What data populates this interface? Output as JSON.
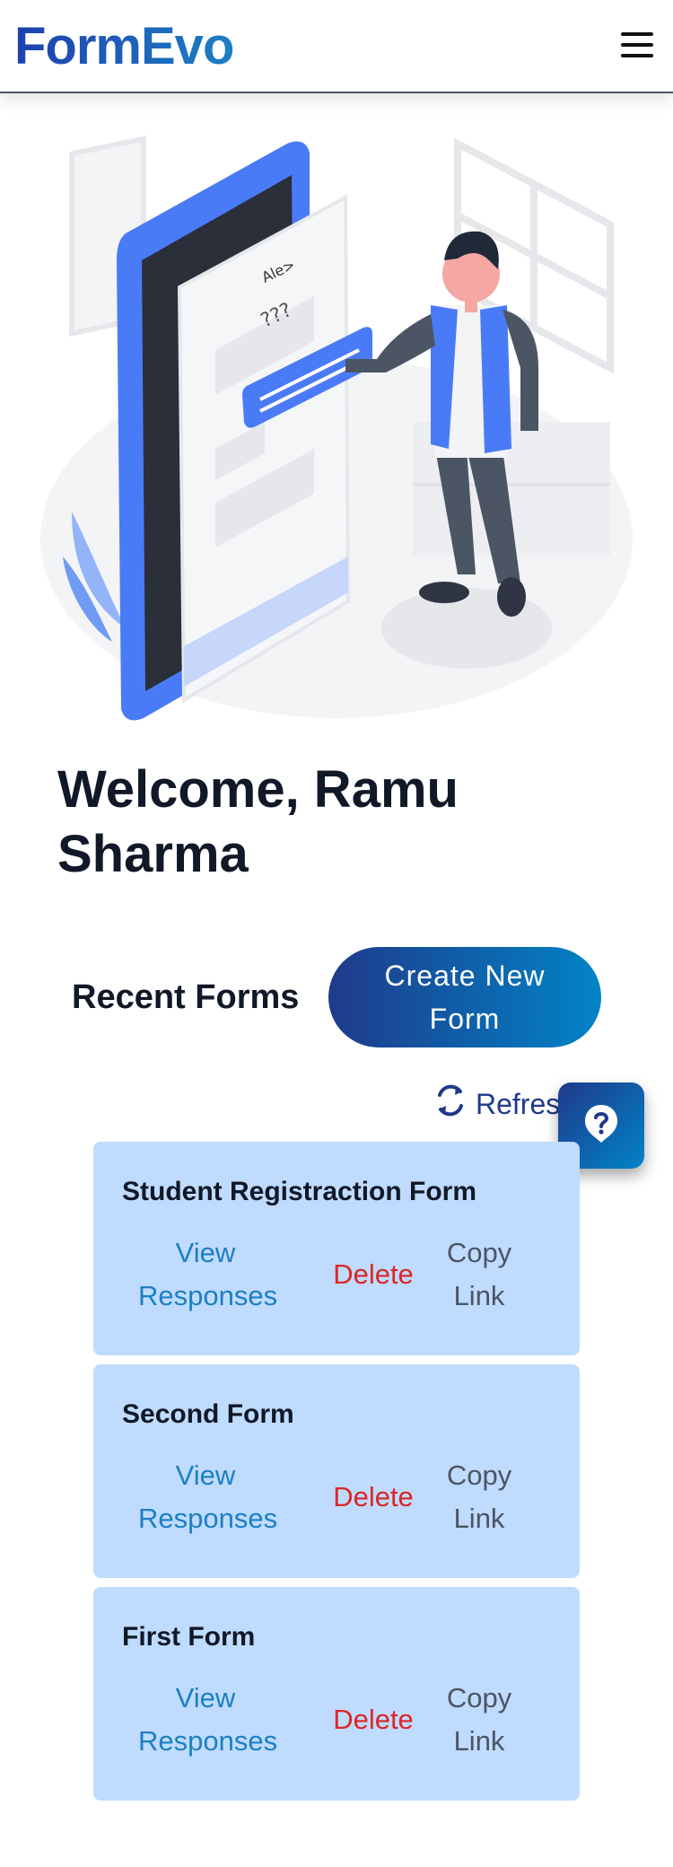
{
  "header": {
    "logo": "FormEvo",
    "menu_icon": "hamburger-menu-icon"
  },
  "hero": {
    "image": "person-chatting-with-phone-illustration"
  },
  "welcome": {
    "title": "Welcome, Ramu Sharma"
  },
  "recent": {
    "title": "Recent Forms",
    "create_label": "Create New Form",
    "refresh_label": "Refresh"
  },
  "help": {
    "icon": "help-question-icon"
  },
  "forms": [
    {
      "title": "Student Registraction Form",
      "view": "View Responses",
      "delete": "Delete",
      "copy": "Copy Link"
    },
    {
      "title": "Second Form",
      "view": "View Responses",
      "delete": "Delete",
      "copy": "Copy Link"
    },
    {
      "title": "First Form",
      "view": "View Responses",
      "delete": "Delete",
      "copy": "Copy Link"
    }
  ],
  "colors": {
    "brand_start": "#1e40af",
    "brand_end": "#0284c7",
    "card_bg": "#bfdbfe",
    "delete": "#dc2626",
    "view": "#1d7fc4"
  }
}
